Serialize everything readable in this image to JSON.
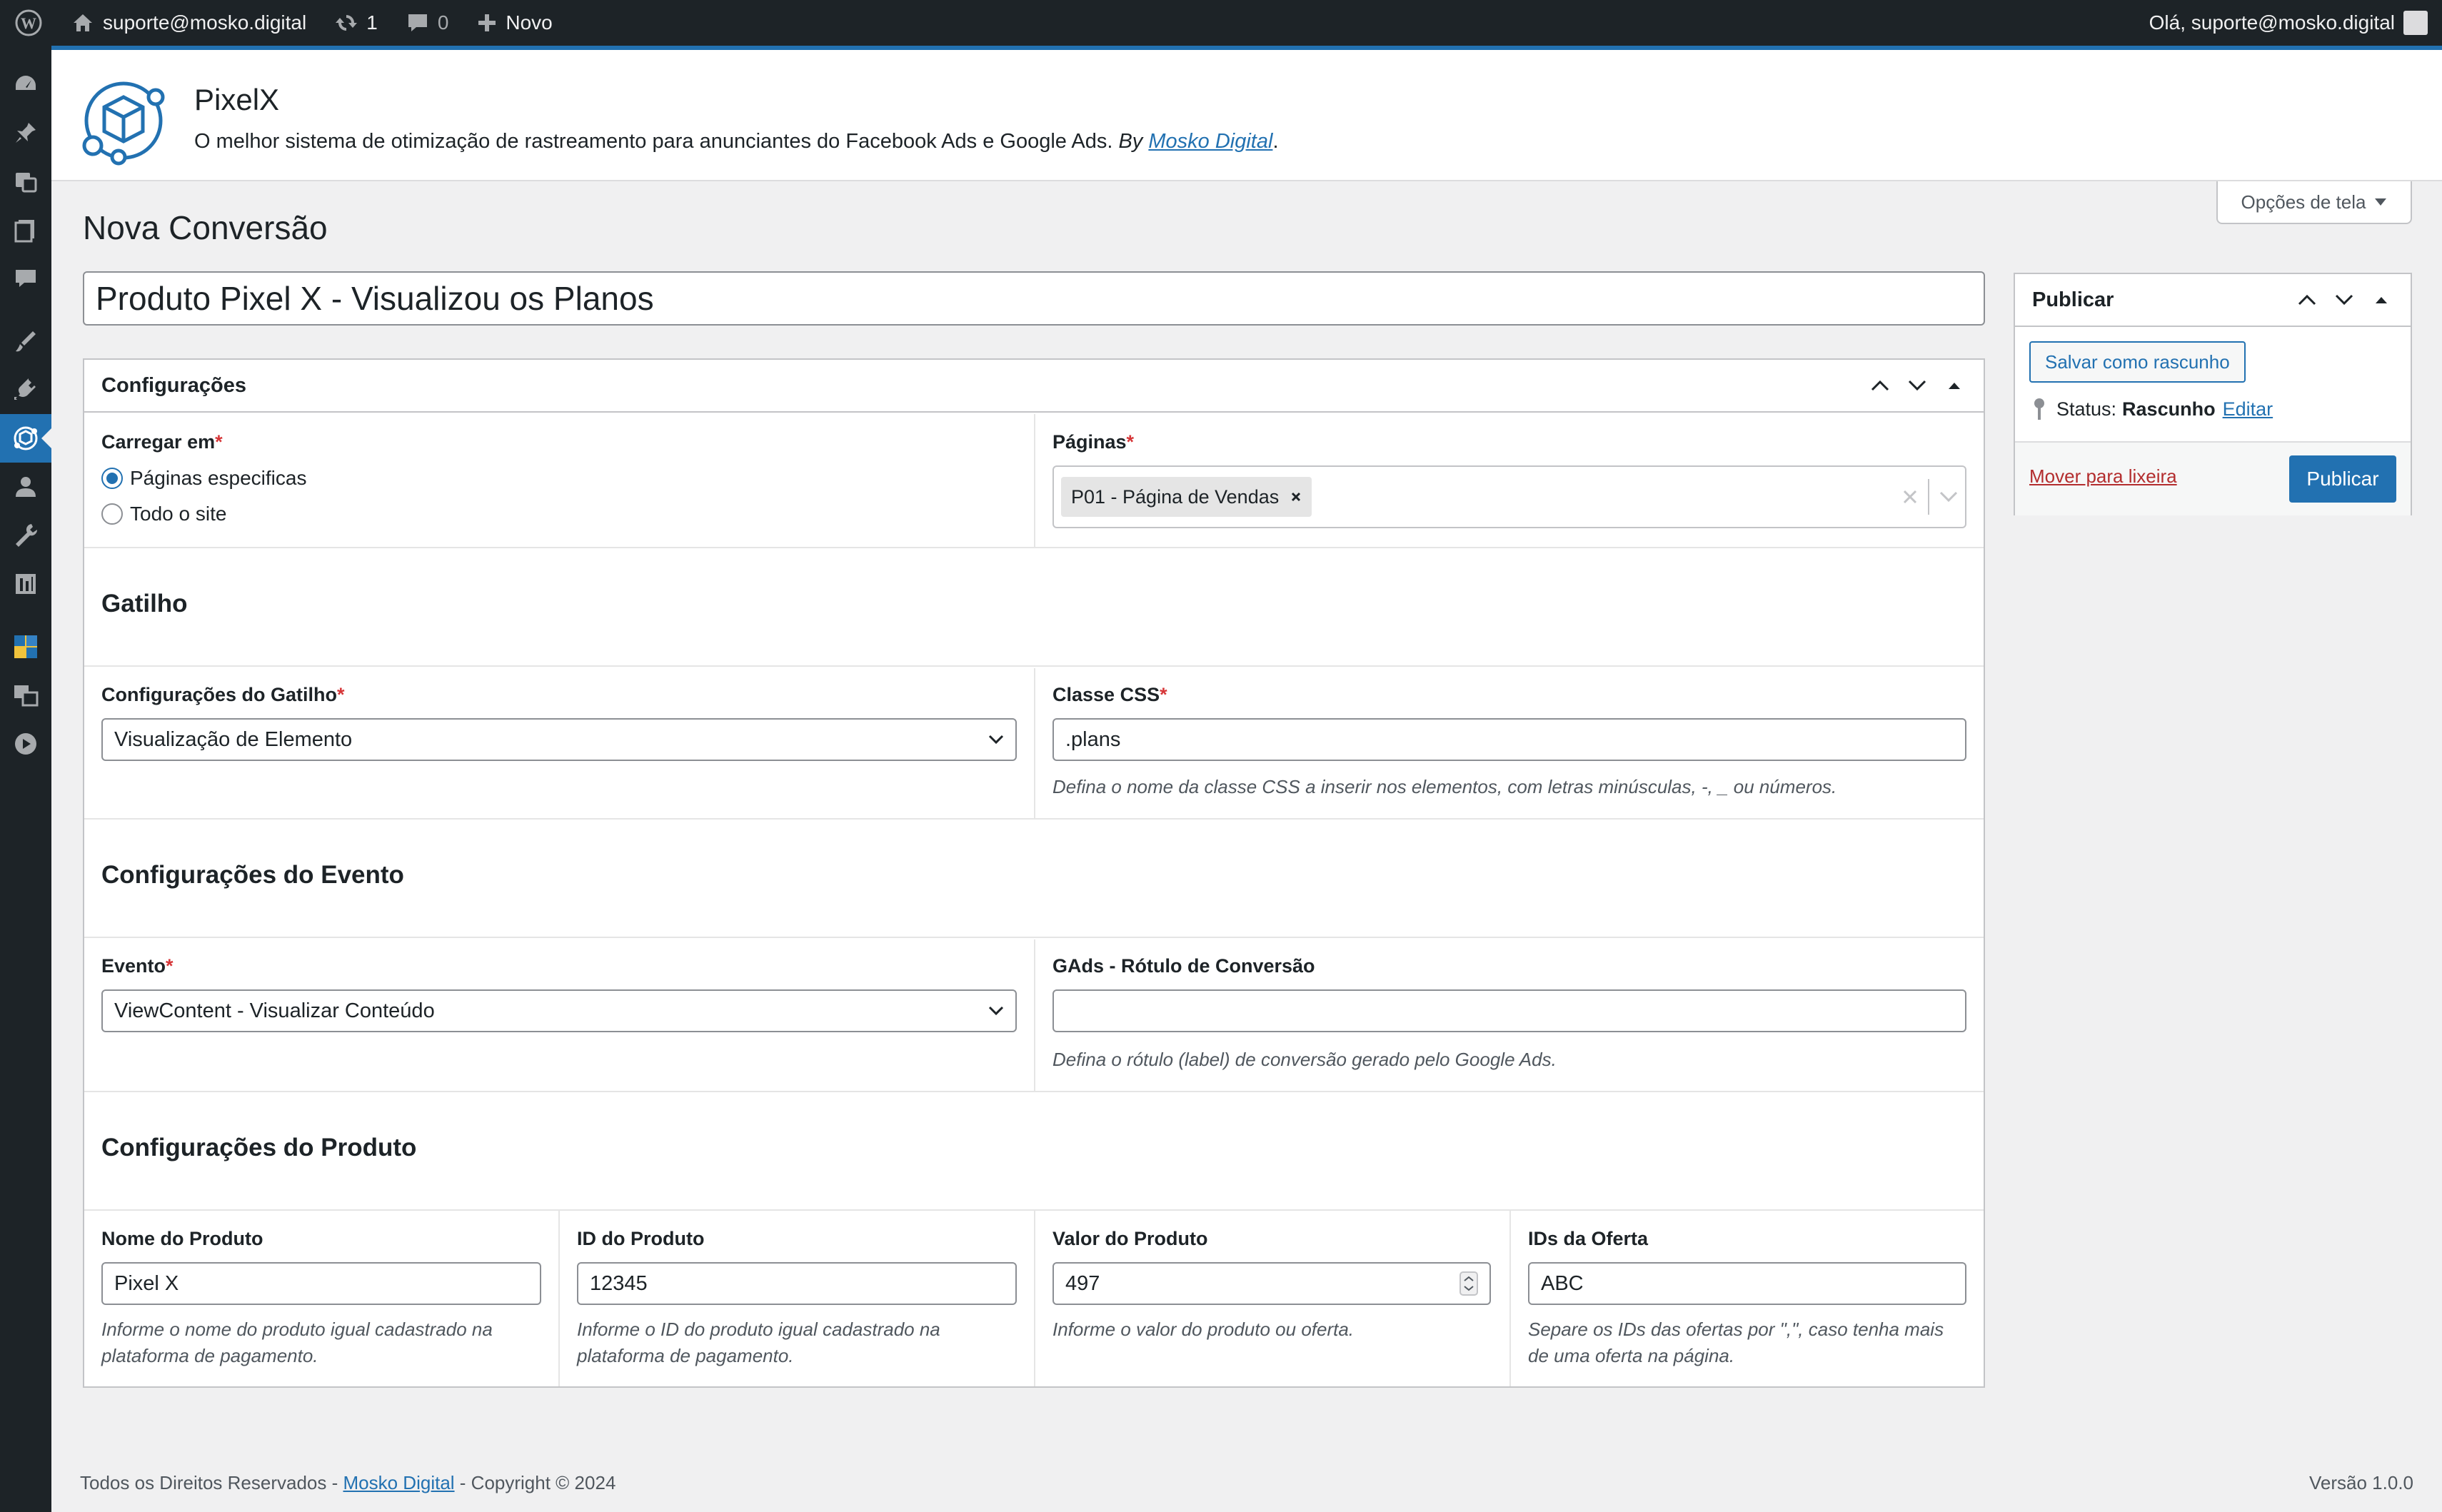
{
  "adminbar": {
    "site_name": "suporte@mosko.digital",
    "updates_count": "1",
    "comments_count": "0",
    "new_label": "Novo",
    "greeting": "Olá, suporte@mosko.digital"
  },
  "sidebar": {
    "icons": [
      "dashboard-icon",
      "pin-icon",
      "media-icon",
      "pages-icon",
      "comments-icon",
      "appearance-icon",
      "plugins-icon",
      "pixelx-icon",
      "users-icon",
      "tools-icon",
      "settings-icon",
      "extension-icon",
      "translate-icon",
      "play-icon"
    ]
  },
  "plugin": {
    "name": "PixelX",
    "description": "O melhor sistema de otimização de rastreamento para anunciantes do Facebook Ads e Google Ads.",
    "by_label": "By",
    "by_link": "Mosko Digital"
  },
  "screen_options": "Opções de tela",
  "page_title": "Nova Conversão",
  "post_title": "Produto Pixel X - Visualizou os Planos",
  "config_box": {
    "title": "Configurações",
    "load_in_label": "Carregar em",
    "load_options": [
      "Páginas especificas",
      "Todo o site"
    ],
    "pages_label": "Páginas",
    "pages_selected": "P01 - Página de Vendas",
    "trigger_section": "Gatilho",
    "trigger_config_label": "Configurações do Gatilho",
    "trigger_config_value": "Visualização de Elemento",
    "css_class_label": "Classe CSS",
    "css_class_value": ".plans",
    "css_class_help": "Defina o nome da classe CSS a inserir nos elementos, com letras minúsculas, -, _ ou números.",
    "event_section": "Configurações do Evento",
    "event_label": "Evento",
    "event_value": "ViewContent - Visualizar Conteúdo",
    "gads_label": "GAds - Rótulo de Conversão",
    "gads_value": "",
    "gads_help": "Defina o rótulo (label) de conversão gerado pelo Google Ads.",
    "product_section": "Configurações do Produto",
    "product_name_label": "Nome do Produto",
    "product_name_value": "Pixel X",
    "product_name_help": "Informe o nome do produto igual cadastrado na plataforma de pagamento.",
    "product_id_label": "ID do Produto",
    "product_id_value": "12345",
    "product_id_help": "Informe o ID do produto igual cadastrado na plataforma de pagamento.",
    "product_value_label": "Valor do Produto",
    "product_value_value": "497",
    "product_value_help": "Informe o valor do produto ou oferta.",
    "offer_ids_label": "IDs da Oferta",
    "offer_ids_value": "ABC",
    "offer_ids_help": "Separe os IDs das ofertas por \",\", caso tenha mais de uma oferta na página."
  },
  "publish": {
    "title": "Publicar",
    "save_draft": "Salvar como rascunho",
    "status_label": "Status:",
    "status_value": "Rascunho",
    "edit_link": "Editar",
    "trash_link": "Mover para lixeira",
    "publish_button": "Publicar"
  },
  "footer": {
    "rights": "Todos os Direitos Reservados -",
    "brand": "Mosko Digital",
    "copyright": "- Copyright © 2024",
    "version": "Versão 1.0.0"
  },
  "colors": {
    "accent": "#2271b1",
    "adminbar": "#1d2327",
    "required": "#d63638",
    "trash": "#b32d2e"
  }
}
